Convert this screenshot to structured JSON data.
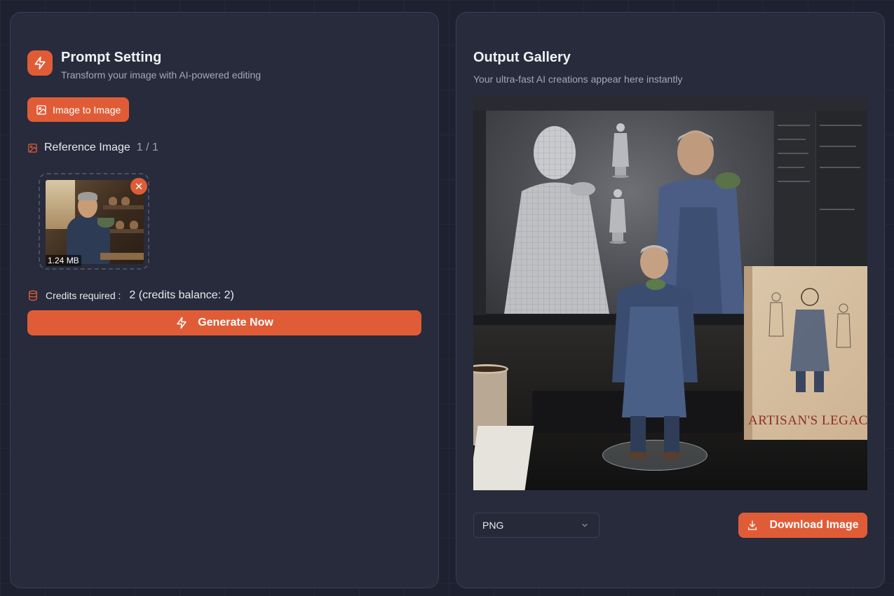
{
  "prompt_panel": {
    "title": "Prompt Setting",
    "subtitle": "Transform your image with AI-powered editing",
    "mode_button_label": "Image to Image",
    "reference_label": "Reference Image",
    "reference_count": "1 / 1",
    "thumbnail_size": "1.24 MB",
    "credits_label": "Credits required :",
    "credits_value": "2 (credits balance: 2)",
    "generate_label": "Generate Now"
  },
  "output_panel": {
    "title": "Output Gallery",
    "subtitle": "Your ultra-fast AI creations appear here instantly",
    "box_title": "ARTISAN'S LEGACY",
    "format_selected": "PNG",
    "download_label": "Download Image"
  },
  "colors": {
    "accent": "#e05c37",
    "panel": "#272b3b",
    "background": "#1d2130"
  },
  "icons": {
    "header": "bolt-icon",
    "mode": "image-icon",
    "reference": "image-icon",
    "remove": "close-icon",
    "credits": "database-icon",
    "generate": "bolt-icon",
    "select": "chevron-down-icon",
    "download": "download-icon"
  }
}
